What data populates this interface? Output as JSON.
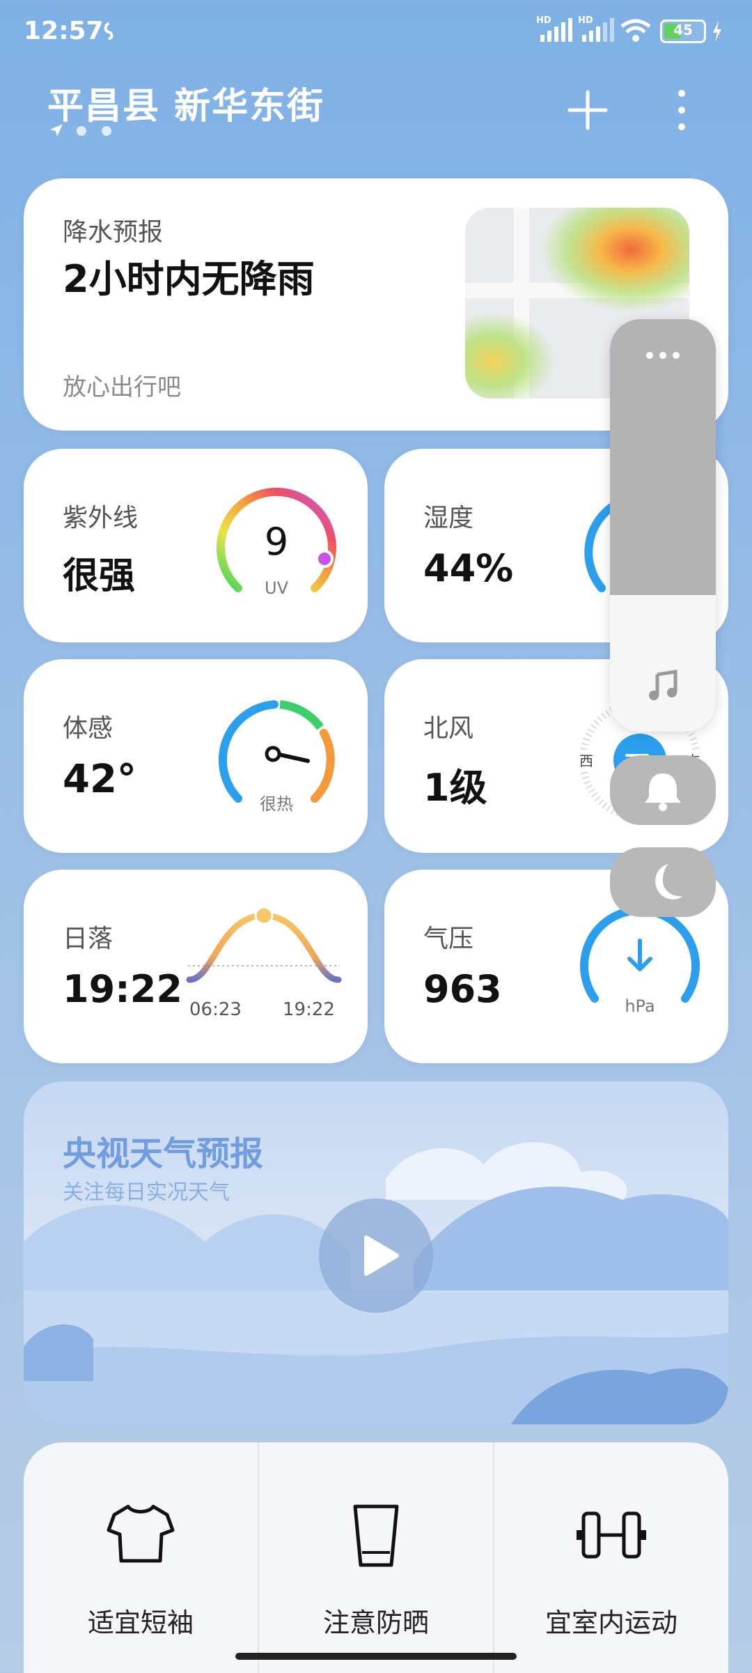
{
  "status_bar": {
    "time": "12:57",
    "battery": "45",
    "signal1": "HD",
    "signal2": "HD"
  },
  "header": {
    "location": "平昌县 新华东街"
  },
  "precip": {
    "label": "降水预报",
    "value": "2小时内无降雨",
    "hint": "放心出行吧"
  },
  "uv": {
    "label": "紫外线",
    "value": "很强",
    "index": "9",
    "unit": "UV"
  },
  "humidity": {
    "label": "湿度",
    "value": "44%"
  },
  "feels": {
    "label": "体感",
    "value": "42°",
    "desc": "很热"
  },
  "wind": {
    "label": "北风",
    "value": "1级",
    "west": "西",
    "east": "东"
  },
  "sunset": {
    "label": "日落",
    "value": "19:22",
    "rise": "06:23",
    "set": "19:22"
  },
  "pressure": {
    "label": "气压",
    "value": "963",
    "unit": "hPa"
  },
  "video": {
    "title": "央视天气预报",
    "subtitle": "关注每日实况天气"
  },
  "tips": [
    {
      "label": "适宜短袖"
    },
    {
      "label": "注意防晒"
    },
    {
      "label": "宜室内运动"
    }
  ]
}
